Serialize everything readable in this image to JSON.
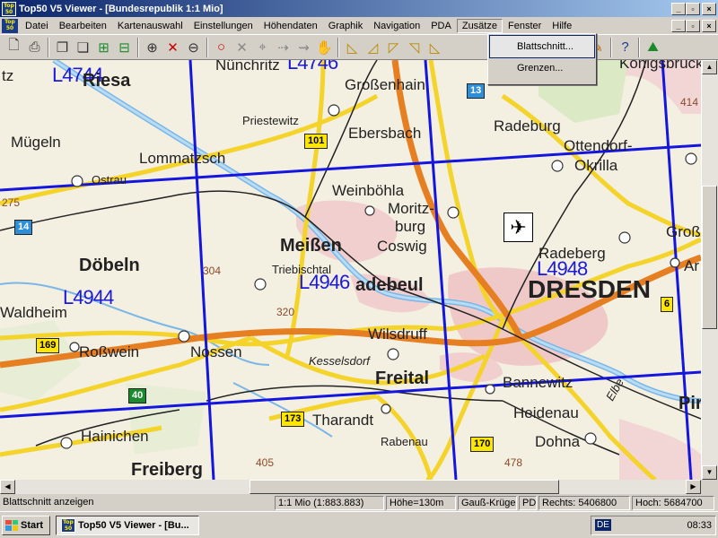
{
  "window": {
    "title": "Top50 V5 Viewer - [Bundesrepublik 1:1 Mio]",
    "icon_label": "Top 50",
    "min": "_",
    "max": "▫",
    "close": "×"
  },
  "menu": {
    "items": [
      "Datei",
      "Bearbeiten",
      "Kartenauswahl",
      "Einstellungen",
      "Höhendaten",
      "Graphik",
      "Navigation",
      "PDA",
      "Zusätze",
      "Fenster",
      "Hilfe"
    ],
    "open_item": "Zusätze"
  },
  "dropdown": {
    "items": [
      "Blattschnitt...",
      "Grenzen..."
    ],
    "highlighted": "Blattschnitt..."
  },
  "toolbar": {
    "icons": [
      "new-icon",
      "print-icon",
      "copy-icon",
      "copy2-icon",
      "zoom-window-icon",
      "zoom-fit-icon",
      "zoom-in-icon",
      "zoom-cross-icon",
      "zoom-out-icon",
      "circle-icon",
      "cancel-icon",
      "measure-icon",
      "route-icon",
      "route2-icon",
      "hand-icon",
      "ruler-icon",
      "ruler2-icon",
      "ruler3-icon",
      "ruler4-icon",
      "ruler5-icon",
      "tools-icon",
      "palette-icon",
      "help-icon",
      "profile-icon"
    ]
  },
  "map": {
    "places": [
      {
        "name": "Riesa",
        "cls": "big"
      },
      {
        "name": "Nünchritz",
        "cls": "med"
      },
      {
        "name": "Großenhain",
        "cls": "med"
      },
      {
        "name": "Königsbrück",
        "cls": "med"
      },
      {
        "name": "Priestewitz",
        "cls": "sm"
      },
      {
        "name": "Ebersbach",
        "cls": "med"
      },
      {
        "name": "Radeburg",
        "cls": "med"
      },
      {
        "name": "Ottendorf-",
        "cls": "med"
      },
      {
        "name": "Okrilla",
        "cls": "med"
      },
      {
        "name": "Mügeln",
        "cls": "med"
      },
      {
        "name": "Lommatzsch",
        "cls": "med"
      },
      {
        "name": "Ostrau",
        "cls": "sm"
      },
      {
        "name": "Weinböhla",
        "cls": "med"
      },
      {
        "name": "Moritz-",
        "cls": "med"
      },
      {
        "name": "burg",
        "cls": "med"
      },
      {
        "name": "Meißen",
        "cls": "big"
      },
      {
        "name": "Coswig",
        "cls": "med"
      },
      {
        "name": "Radeberg",
        "cls": "med"
      },
      {
        "name": "Döbeln",
        "cls": "big"
      },
      {
        "name": "Triebischtal",
        "cls": "sm"
      },
      {
        "name": "adebeul",
        "cls": "big"
      },
      {
        "name": "DRESDEN",
        "cls": "huge"
      },
      {
        "name": "Waldheim",
        "cls": "med"
      },
      {
        "name": "Roßwein",
        "cls": "med"
      },
      {
        "name": "Nossen",
        "cls": "med"
      },
      {
        "name": "Wilsdruff",
        "cls": "med"
      },
      {
        "name": "Kesselsdorf",
        "cls": "sm ital"
      },
      {
        "name": "Freital",
        "cls": "big"
      },
      {
        "name": "Bannewitz",
        "cls": "med"
      },
      {
        "name": "Pirn",
        "cls": "big"
      },
      {
        "name": "Heidenau",
        "cls": "med"
      },
      {
        "name": "Hainichen",
        "cls": "med"
      },
      {
        "name": "Tharandt",
        "cls": "med"
      },
      {
        "name": "Rabenau",
        "cls": "sm"
      },
      {
        "name": "Dohna",
        "cls": "med"
      },
      {
        "name": "Freiberg",
        "cls": "big"
      },
      {
        "name": "Elbe",
        "cls": "sm ital"
      },
      {
        "name": "Groß",
        "cls": "med"
      },
      {
        "name": "Ar",
        "cls": "med"
      },
      {
        "name": "tz",
        "cls": "med"
      }
    ],
    "sheets": [
      "L4744",
      "L4746",
      "L4944",
      "L4946",
      "L4948"
    ],
    "shields": [
      {
        "label": "13",
        "type": "blue"
      },
      {
        "label": "101",
        "type": "yellow"
      },
      {
        "label": "14",
        "type": "blue"
      },
      {
        "label": "169",
        "type": "yellow"
      },
      {
        "label": "40",
        "type": "green"
      },
      {
        "label": "6",
        "type": "yellow"
      },
      {
        "label": "173",
        "type": "yellow"
      },
      {
        "label": "170",
        "type": "yellow"
      }
    ],
    "elevations": [
      "304",
      "320",
      "275",
      "414",
      "405",
      "478"
    ],
    "airport_icon": "airplane-icon"
  },
  "status": {
    "message": "Blattschnitt anzeigen",
    "scale": "1:1 Mio (1:883.883)",
    "height": "Höhe=130m",
    "projection": "Gauß-Krüger",
    "pd": "PD",
    "right": "Rechts: 5406800",
    "up": "Hoch: 5684700"
  },
  "taskbar": {
    "start": "Start",
    "app": "Top50 V5 Viewer - [Bu...",
    "lang": "DE",
    "clock": "08:33"
  }
}
